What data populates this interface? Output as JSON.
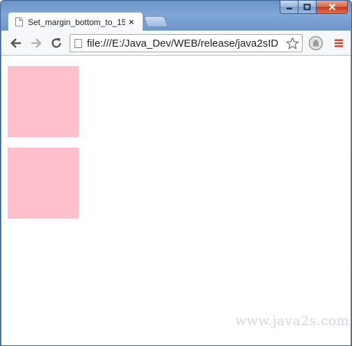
{
  "tab": {
    "title": "Set_margin_bottom_to_15",
    "close_glyph": "×"
  },
  "toolbar": {
    "url": "file:///E:/Java_Dev/WEB/release/java2sID"
  },
  "watermark": "www.java2s.com",
  "colors": {
    "box": "#ffc0cb",
    "frame": "#6b93c7",
    "menu_icon": "#d9392b"
  },
  "icons": {
    "back": "back-arrow-icon",
    "forward": "forward-arrow-icon",
    "reload": "reload-icon",
    "page": "page-icon",
    "bookmark": "star-icon",
    "extension": "hand-icon",
    "menu": "menu-icon"
  }
}
